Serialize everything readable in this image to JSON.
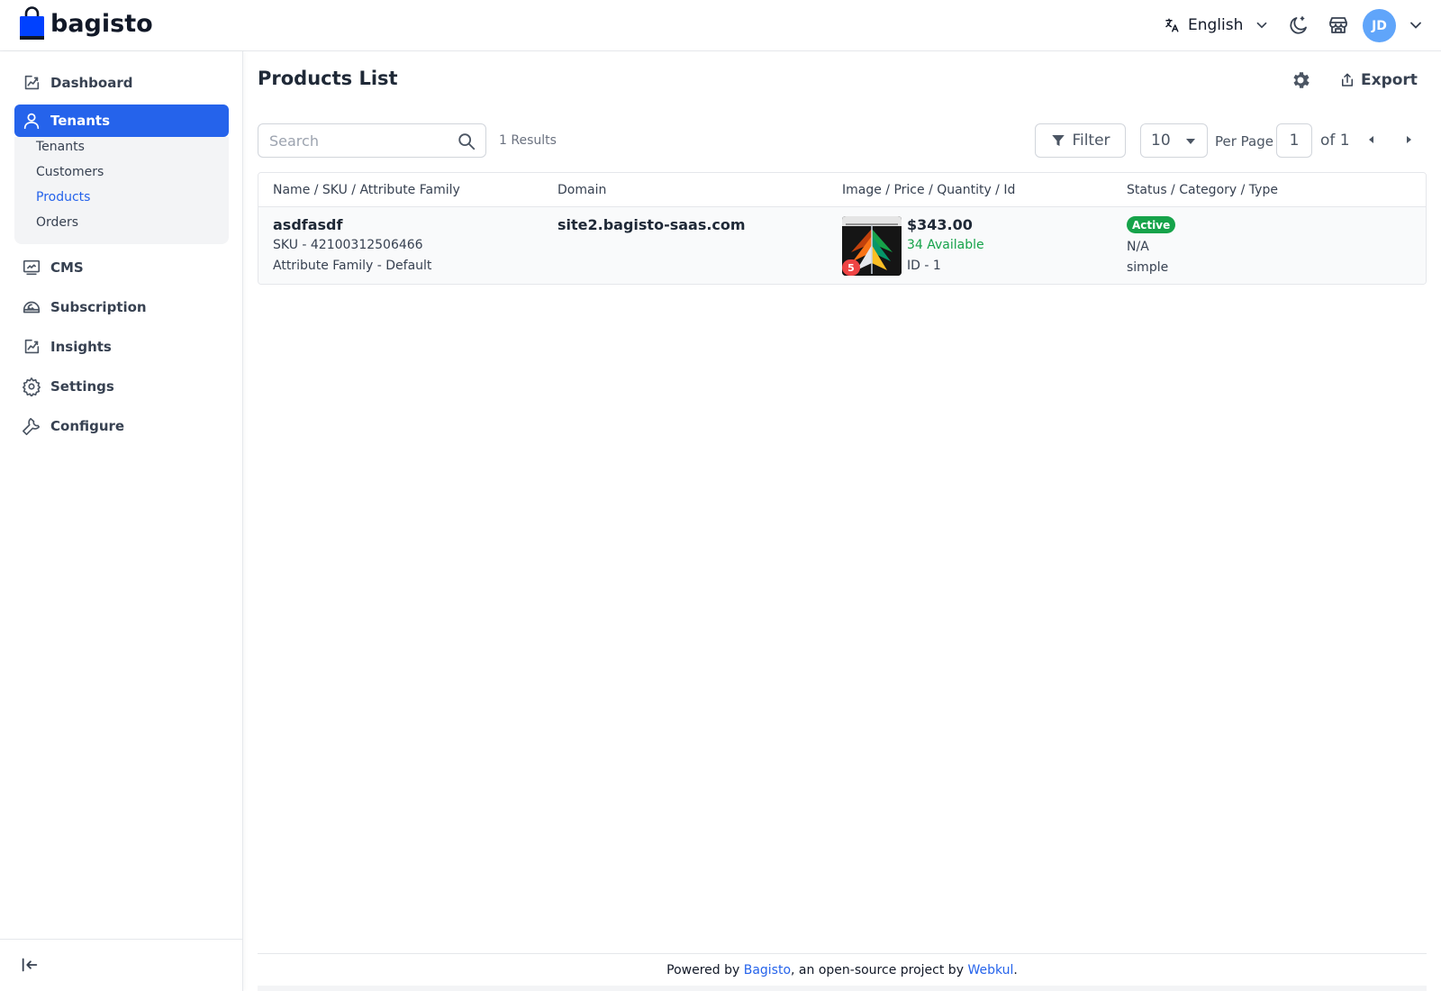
{
  "brand": {
    "name": "bagisto"
  },
  "header": {
    "language": "English",
    "avatar_initials": "JD"
  },
  "sidebar": {
    "items": [
      {
        "label": "Dashboard",
        "icon": "dashboard-icon"
      },
      {
        "label": "Tenants",
        "icon": "user-icon",
        "active": true
      },
      {
        "label": "CMS",
        "icon": "cms-icon"
      },
      {
        "label": "Subscription",
        "icon": "subscription-icon"
      },
      {
        "label": "Insights",
        "icon": "insights-icon"
      },
      {
        "label": "Settings",
        "icon": "gear-icon"
      },
      {
        "label": "Configure",
        "icon": "wrench-icon"
      }
    ],
    "submenu": [
      {
        "label": "Tenants"
      },
      {
        "label": "Customers"
      },
      {
        "label": "Products",
        "active": true
      },
      {
        "label": "Orders"
      }
    ]
  },
  "page": {
    "title": "Products List",
    "export_label": "Export",
    "search_placeholder": "Search",
    "results": "1 Results",
    "filter_label": "Filter",
    "per_page_value": "10",
    "per_page_label": "Per Page",
    "page_value": "1",
    "of_label": "of 1"
  },
  "table": {
    "headers": [
      "Name / SKU / Attribute Family",
      "Domain",
      "Image / Price / Quantity / Id",
      "Status / Category / Type"
    ],
    "rows": [
      {
        "name": "asdfasdf",
        "sku": "SKU - 42100312506466",
        "family": "Attribute Family - Default",
        "domain": "site2.bagisto-saas.com",
        "image_count": "5",
        "price": "$343.00",
        "quantity": "34 Available",
        "id": "ID - 1",
        "status": "Active",
        "category": "N/A",
        "type": "simple"
      }
    ]
  },
  "footer": {
    "prefix": "Powered by ",
    "link1": "Bagisto",
    "middle": ", an open-source project by ",
    "link2": "Webkul",
    "suffix": "."
  },
  "colors": {
    "primary": "#2563eb",
    "success": "#16a34a",
    "badge_red": "#ef4444",
    "avatar": "#60a5fa"
  }
}
